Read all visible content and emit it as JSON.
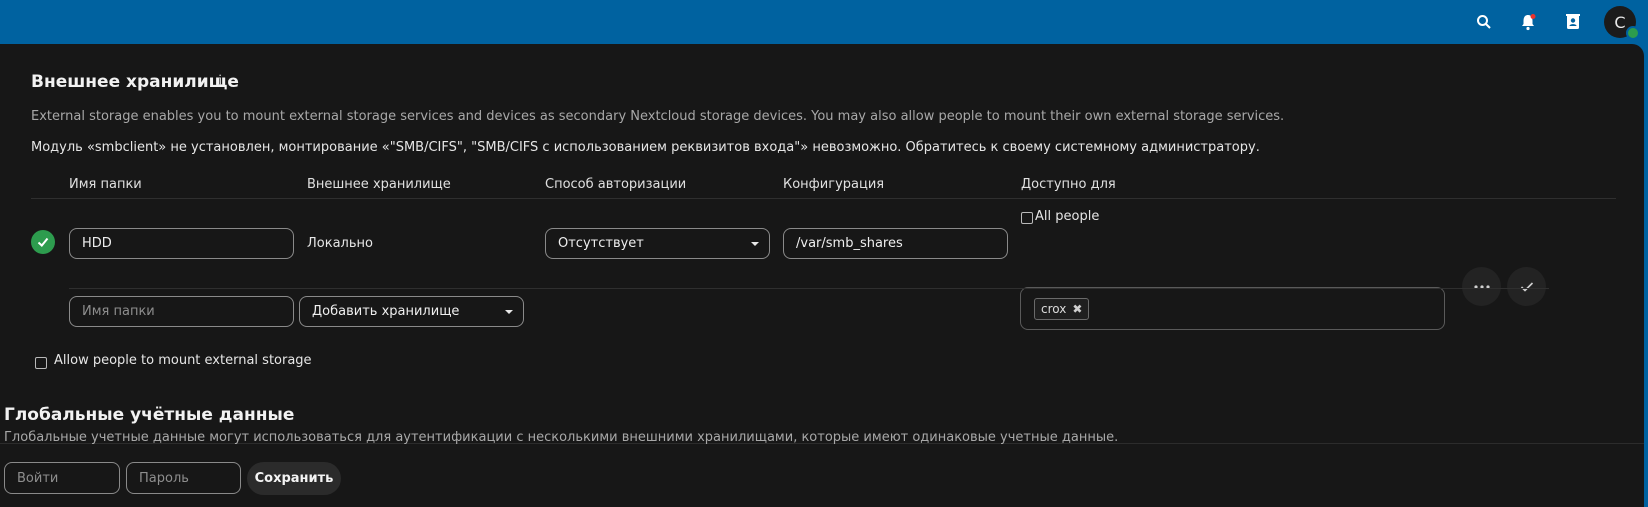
{
  "topbar": {
    "icons": [
      "search-icon",
      "notifications-icon",
      "contacts-icon"
    ],
    "avatar_letter": "C",
    "accent": "#0062a0"
  },
  "external_storage": {
    "title": "Внешнее хранилище",
    "description": "External storage enables you to mount external storage services and devices as secondary Nextcloud storage devices. You may also allow people to mount their own external storage services.",
    "warning": "Модуль «smbclient» не установлен, монтирование «\"SMB/CIFS\", \"SMB/CIFS с использованием реквизитов входа\"» невозможно. Обратитесь к своему системному администратору.",
    "columns": [
      "Имя папки",
      "Внешнее хранилище",
      "Способ авторизации",
      "Конфигурация",
      "Доступно для"
    ],
    "row": {
      "status": "ok",
      "folder_name": "HDD",
      "backend": "Локально",
      "auth": "Отсутствует",
      "config": "/var/smb_shares",
      "all_people_label": "All people",
      "all_people_checked": false,
      "applicable_tags": [
        "crox"
      ]
    },
    "new_row": {
      "folder_placeholder": "Имя папки",
      "add_storage_label": "Добавить хранилище"
    },
    "allow_user_mounting_label": "Allow people to mount external storage",
    "allow_user_mounting_checked": false
  },
  "global_credentials": {
    "title": "Глобальные учётные данные",
    "description": "Глобальные учетные данные могут использоваться для аутентификации с несколькими внешними хранилищами, которые имеют одинаковые учетные данные.",
    "login_placeholder": "Войти",
    "password_placeholder": "Пароль",
    "save_label": "Сохранить"
  },
  "colors": {
    "success": "#2d9c4e",
    "background": "#171717"
  }
}
